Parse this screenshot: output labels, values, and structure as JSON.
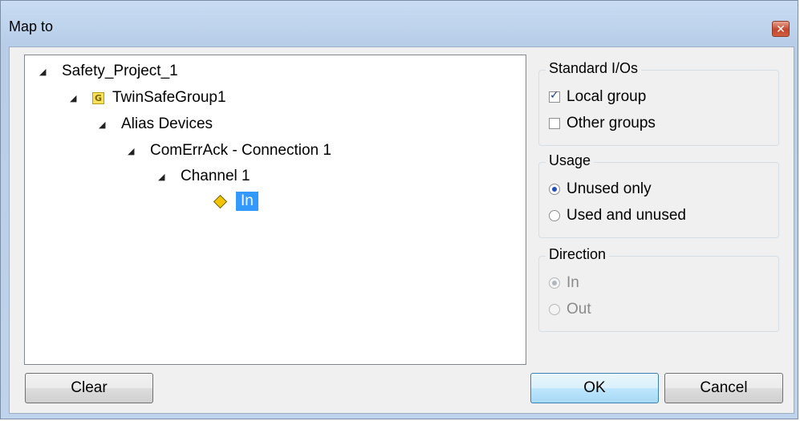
{
  "window": {
    "title": "Map to"
  },
  "tree": {
    "root": "Safety_Project_1",
    "group": "TwinSafeGroup1",
    "group_icon": "G",
    "alias": "Alias Devices",
    "connection": "ComErrAck - Connection 1",
    "channel": "Channel 1",
    "selected_item": "In"
  },
  "standard_ios": {
    "label": "Standard I/Os",
    "local_group": {
      "label": "Local group",
      "checked": true
    },
    "other_groups": {
      "label": "Other groups",
      "checked": false
    }
  },
  "usage": {
    "label": "Usage",
    "unused_only": {
      "label": "Unused only",
      "selected": true
    },
    "used_and_unused": {
      "label": "Used and unused",
      "selected": false
    }
  },
  "direction": {
    "label": "Direction",
    "in": {
      "label": "In",
      "selected": true,
      "enabled": false
    },
    "out": {
      "label": "Out",
      "selected": false,
      "enabled": false
    }
  },
  "buttons": {
    "clear": "Clear",
    "ok": "OK",
    "cancel": "Cancel"
  },
  "colors": {
    "selection": "#3399ff",
    "title_bar": "#c9dcf3",
    "close_button": "#c2462a"
  }
}
